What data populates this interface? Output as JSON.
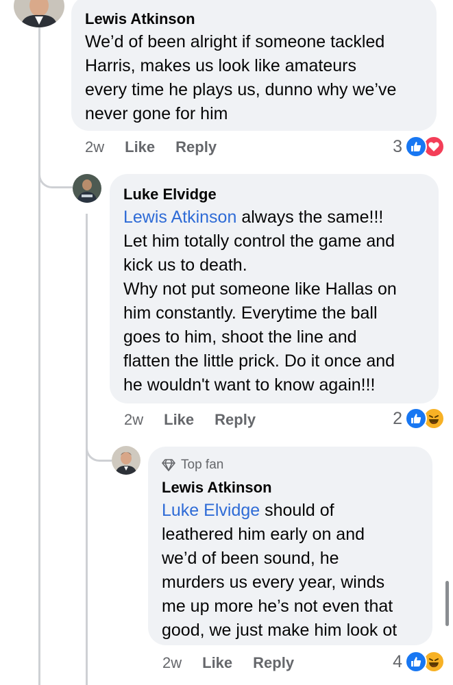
{
  "comments": [
    {
      "author": "Lewis Atkinson",
      "text": "We’d of been alright if someone tackled\nHarris, makes us look like amateurs\nevery time he plays us, dunno why we’ve\nnever gone for him",
      "time": "2w",
      "like_label": "Like",
      "reply_label": "Reply",
      "reaction_count": "3",
      "reactions": [
        "like-icon",
        "love-icon"
      ]
    },
    {
      "author": "Luke Elvidge",
      "mention": "Lewis Atkinson",
      "text": " always the same!!!\nLet him totally control the game and\nkick us to death.\nWhy not put someone like Hallas on\nhim constantly. Everytime the ball\ngoes to him, shoot the line and\nflatten the little prick. Do it once and\nhe wouldn't want to know again!!!",
      "time": "2w",
      "like_label": "Like",
      "reply_label": "Reply",
      "reaction_count": "2",
      "reactions": [
        "like-icon",
        "haha-icon"
      ]
    },
    {
      "badge": "Top fan",
      "author": "Lewis Atkinson",
      "mention": "Luke Elvidge",
      "text": " should of\nleathered him early on and\nwe’d of been sound, he\nmurders us every year, winds\nme up more he’s not even that\ngood, we just make him look ot",
      "time": "2w",
      "like_label": "Like",
      "reply_label": "Reply",
      "reaction_count": "4",
      "reactions": [
        "like-icon",
        "haha-icon"
      ]
    }
  ],
  "colors": {
    "bubble": "#f0f2f5",
    "mention": "#2e6bd6",
    "like": "#1877f2",
    "love": "#f33e58",
    "haha": "#f7b125",
    "meta": "#65676b"
  }
}
